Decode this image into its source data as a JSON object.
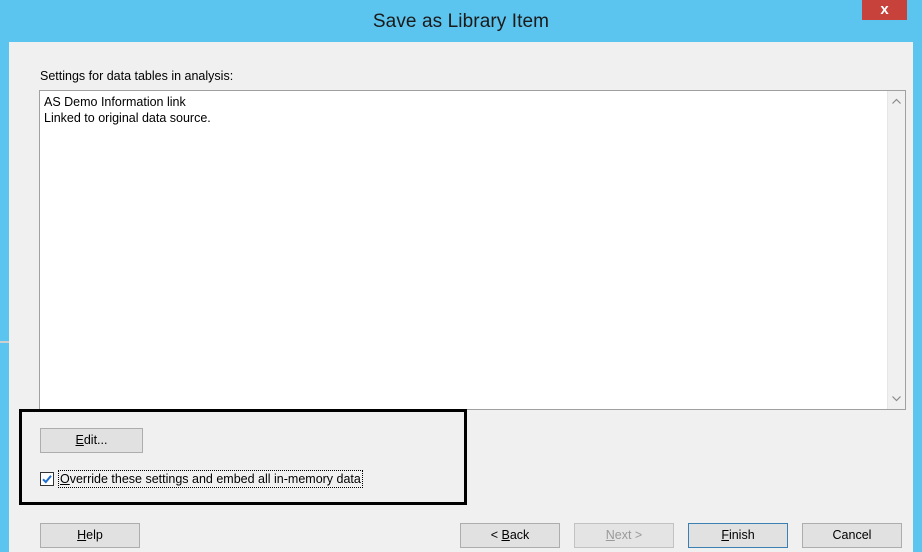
{
  "window": {
    "title": "Save as Library Item",
    "close_label": "x"
  },
  "settings": {
    "label": "Settings for data tables in analysis:",
    "lines": [
      "AS Demo Information link",
      "Linked to original data source."
    ]
  },
  "edit_button": {
    "mnemonic": "E",
    "rest": "dit..."
  },
  "override_checkbox": {
    "checked": true,
    "mnemonic": "O",
    "rest": "verride these settings and embed all in-memory data"
  },
  "footer": {
    "help": {
      "mnemonic": "H",
      "rest": "elp"
    },
    "back": {
      "prefix": "< ",
      "mnemonic": "B",
      "rest": "ack"
    },
    "next": {
      "mnemonic": "N",
      "rest": "ext >",
      "enabled": false
    },
    "finish": {
      "mnemonic": "F",
      "rest": "inish"
    },
    "cancel": {
      "label": "Cancel"
    }
  },
  "icons": {
    "scroll_up": "scroll-up-arrow-icon",
    "scroll_down": "scroll-down-arrow-icon",
    "checkmark": "checkmark-icon"
  },
  "colors": {
    "titlebar": "#5cc5ef",
    "close_button": "#c7423a",
    "checkmark": "#1f6fd1"
  }
}
